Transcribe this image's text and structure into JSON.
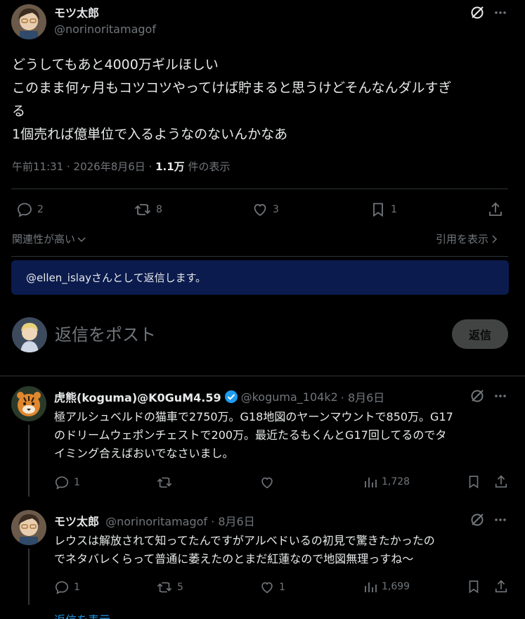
{
  "main_post": {
    "author_name": "モツ太郎",
    "handle": "@norinoritamagof",
    "body_lines": [
      "どうしてもあと4000万ギルほしい",
      "このまま何ヶ月もコツコツやってけば貯まると思うけどそんなんダルすぎ",
      "る",
      "1個売れば億単位で入るようなのないんかなあ"
    ],
    "time": "午前11:31 · 2026年8月6日 · ",
    "views_count": "1.1万",
    "views_label": " 件の表示",
    "replies": "2",
    "reposts": "8",
    "likes": "3",
    "bookmarks": "1"
  },
  "sort": {
    "label": "関連性が高い",
    "quotes_link": "引用を表示"
  },
  "reply_banner": "@ellen_islayさんとして返信します。",
  "composer": {
    "placeholder": "返信をポスト",
    "button": "返信"
  },
  "replies": [
    {
      "name": "虎熊(koguma)@K0GuM4.59",
      "handle": "@koguma_104k2",
      "date": "· 8月6日",
      "lines": [
        "極アルシュベルドの猫車で2750万。G18地図のヤーンマウントで850万。G17",
        "のドリームウェポンチェストで200万。最近たるもくんとG17回してるのでタ",
        "イミング合えばおいでなさいまし。"
      ],
      "replies": "1",
      "reposts": "",
      "likes": "",
      "views": "1,728"
    },
    {
      "name": "モツ太郎",
      "handle": "@norinoritamagof",
      "date": "· 8月6日",
      "lines": [
        "レウスは解放されて知ってたんですがアルベドいるの初見で驚きたかったの",
        "でネタバレくらって普通に萎えたのとまだ紅蓮なので地図無理っすね〜"
      ],
      "replies": "1",
      "reposts": "5",
      "likes": "1",
      "views": "1,699"
    }
  ],
  "show_replies": "返信を表示",
  "colors": {
    "background": "#000000",
    "text": "#e7e9ea",
    "muted": "#71767b",
    "banner_bg": "#0b1b4d",
    "link": "#1d9bf0",
    "divider": "#2f3336",
    "verified": "#1d9bf0"
  }
}
